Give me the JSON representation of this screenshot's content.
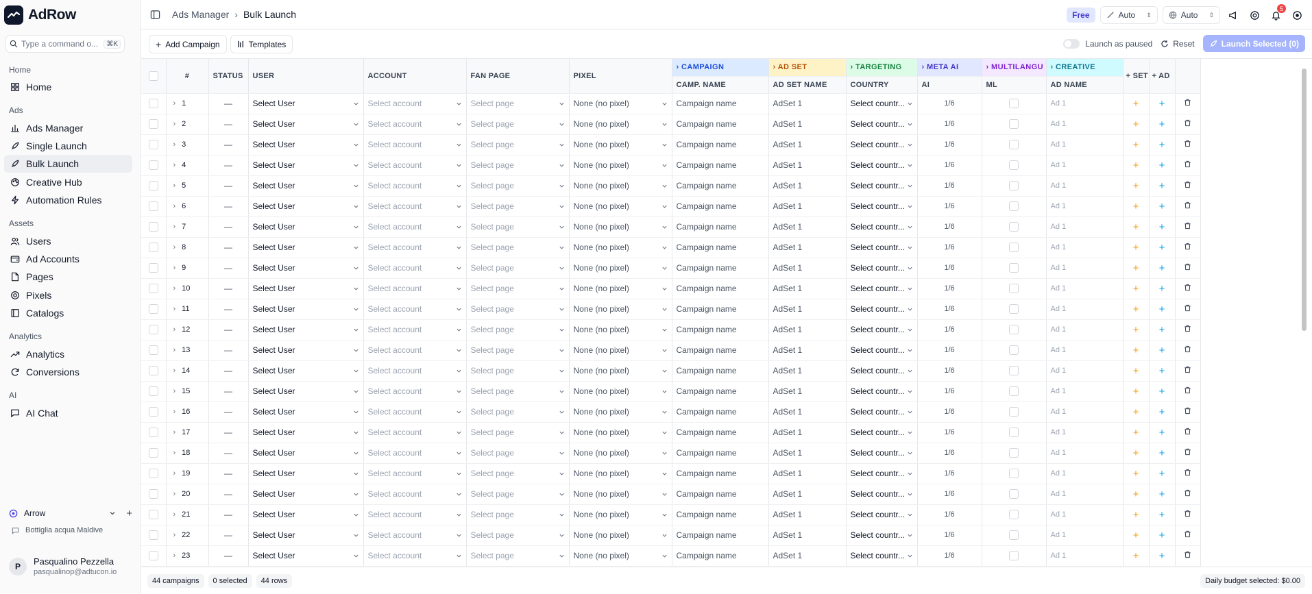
{
  "app": {
    "name": "AdRow"
  },
  "command": {
    "placeholder": "Type a command o...",
    "shortcut": "⌘K"
  },
  "sidebar": {
    "sections": [
      {
        "label": "Home",
        "items": [
          {
            "label": "Home",
            "icon": "grid-icon"
          }
        ]
      },
      {
        "label": "Ads",
        "items": [
          {
            "label": "Ads Manager",
            "icon": "chart-bar-icon"
          },
          {
            "label": "Single Launch",
            "icon": "rocket-icon"
          },
          {
            "label": "Bulk Launch",
            "icon": "rocket-icon",
            "active": true
          },
          {
            "label": "Creative Hub",
            "icon": "palette-icon"
          },
          {
            "label": "Automation Rules",
            "icon": "zap-icon"
          }
        ]
      },
      {
        "label": "Assets",
        "items": [
          {
            "label": "Users",
            "icon": "users-icon"
          },
          {
            "label": "Ad Accounts",
            "icon": "wallet-icon"
          },
          {
            "label": "Pages",
            "icon": "file-icon"
          },
          {
            "label": "Pixels",
            "icon": "target-icon"
          },
          {
            "label": "Catalogs",
            "icon": "book-icon"
          }
        ]
      },
      {
        "label": "Analytics",
        "items": [
          {
            "label": "Analytics",
            "icon": "trending-up-icon"
          },
          {
            "label": "Conversions",
            "icon": "refresh-icon"
          }
        ]
      },
      {
        "label": "AI",
        "items": [
          {
            "label": "AI Chat",
            "icon": "message-icon"
          }
        ]
      }
    ],
    "workspace": "Arrow",
    "workspace_sub": "Bottiglia acqua Maldive",
    "user": {
      "initial": "P",
      "name": "Pasqualino Pezzella",
      "email": "pasqualinop@adtucon.io"
    }
  },
  "breadcrumb": {
    "parent": "Ads Manager",
    "current": "Bulk Launch"
  },
  "topbar": {
    "plan": "Free",
    "select1": "Auto",
    "select2": "Auto",
    "notifications": "5"
  },
  "toolbar": {
    "add_campaign": "Add Campaign",
    "templates": "Templates",
    "launch_paused": "Launch as paused",
    "reset": "Reset",
    "launch_selected": "Launch Selected (0)"
  },
  "columns": {
    "num": "#",
    "status": "STATUS",
    "user": "USER",
    "account": "ACCOUNT",
    "fan_page": "FAN PAGE",
    "pixel": "PIXEL",
    "g_campaign": "CAMPAIGN",
    "g_adset": "AD SET",
    "g_targeting": "TARGETING",
    "g_meta": "META AI",
    "g_multi": "MULTILANGU",
    "g_creative": "CREATIVE",
    "camp_name": "CAMP. NAME",
    "adset_name": "AD SET NAME",
    "country": "COUNTRY",
    "ai": "AI",
    "ml": "ML",
    "ad_name": "AD NAME",
    "set_btn": "+ SET",
    "ad_btn": "+ AD"
  },
  "row_template": {
    "status": "—",
    "user": "Select User",
    "account": "Select account",
    "page": "Select page",
    "pixel": "None (no pixel)",
    "campaign": "Campaign name",
    "adset": "AdSet 1",
    "country": "Select countr...",
    "ai": "1/6",
    "ad": "Ad 1"
  },
  "rows": [
    "1",
    "2",
    "3",
    "4",
    "5",
    "6",
    "7",
    "8",
    "9",
    "10",
    "11",
    "12",
    "13",
    "14",
    "15",
    "16",
    "17",
    "18",
    "19",
    "20",
    "21",
    "22",
    "23"
  ],
  "footer": {
    "campaigns": "44 campaigns",
    "selected": "0 selected",
    "rows": "44 rows",
    "budget": "Daily budget selected: $0.00"
  },
  "colors": {
    "accent": "#4f46e5",
    "launch": "#a5b4fc",
    "plus_set": "#f59e0b",
    "plus_ad": "#0ea5e9"
  }
}
